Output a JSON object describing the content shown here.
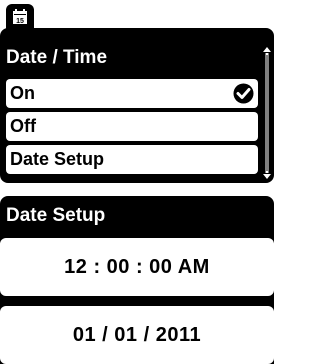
{
  "header": {
    "tab_icon": "calendar-icon",
    "tab_icon_day": "15"
  },
  "date_time_menu": {
    "title": "Date / Time",
    "items": [
      {
        "label": "On",
        "selected": true,
        "check_icon": "checkmark-circle-icon"
      },
      {
        "label": "Off",
        "selected": false
      },
      {
        "label": "Date Setup",
        "selected": false
      }
    ],
    "scrollbar": {
      "up_icon": "scroll-up-arrow-icon",
      "down_icon": "scroll-down-arrow-icon"
    }
  },
  "date_setup": {
    "title": "Date Setup",
    "time": "12 : 00 : 00  AM",
    "date": "01 / 01 / 2011"
  },
  "colors": {
    "panel": "#000000",
    "item": "#ffffff",
    "text": "#000000"
  }
}
